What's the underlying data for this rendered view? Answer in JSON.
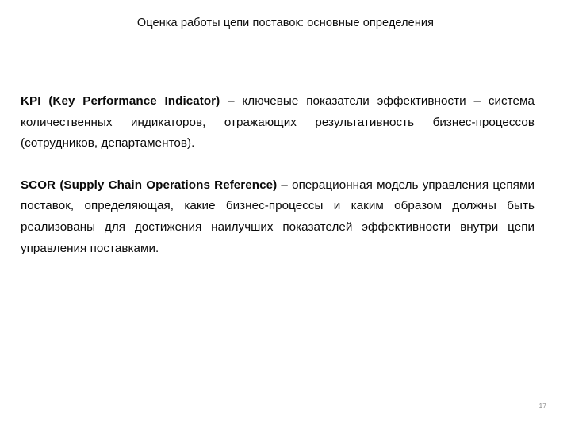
{
  "slide": {
    "title": "Оценка работы цепи поставок: основные определения",
    "page_number": "17",
    "paragraphs": [
      {
        "term": "KPI (Key Performance Indicator)",
        "definition": " – ключевые показатели эффективности – система количественных индикаторов, отражающих результативность бизнес-процессов (сотрудников, департаментов)."
      },
      {
        "term": "SCOR (Supply Chain Operations Reference)",
        "definition": " – операционная модель управления цепями поставок, определяющая, какие бизнес-процессы и каким образом должны быть реализованы для достижения наилучших показателей эффективности внутри цепи управления поставками."
      }
    ]
  },
  "colors": {
    "background": "#ffffff",
    "text": "#0a0a0a",
    "title": "#0d0d0d",
    "page_number": "#8c8c8c"
  }
}
